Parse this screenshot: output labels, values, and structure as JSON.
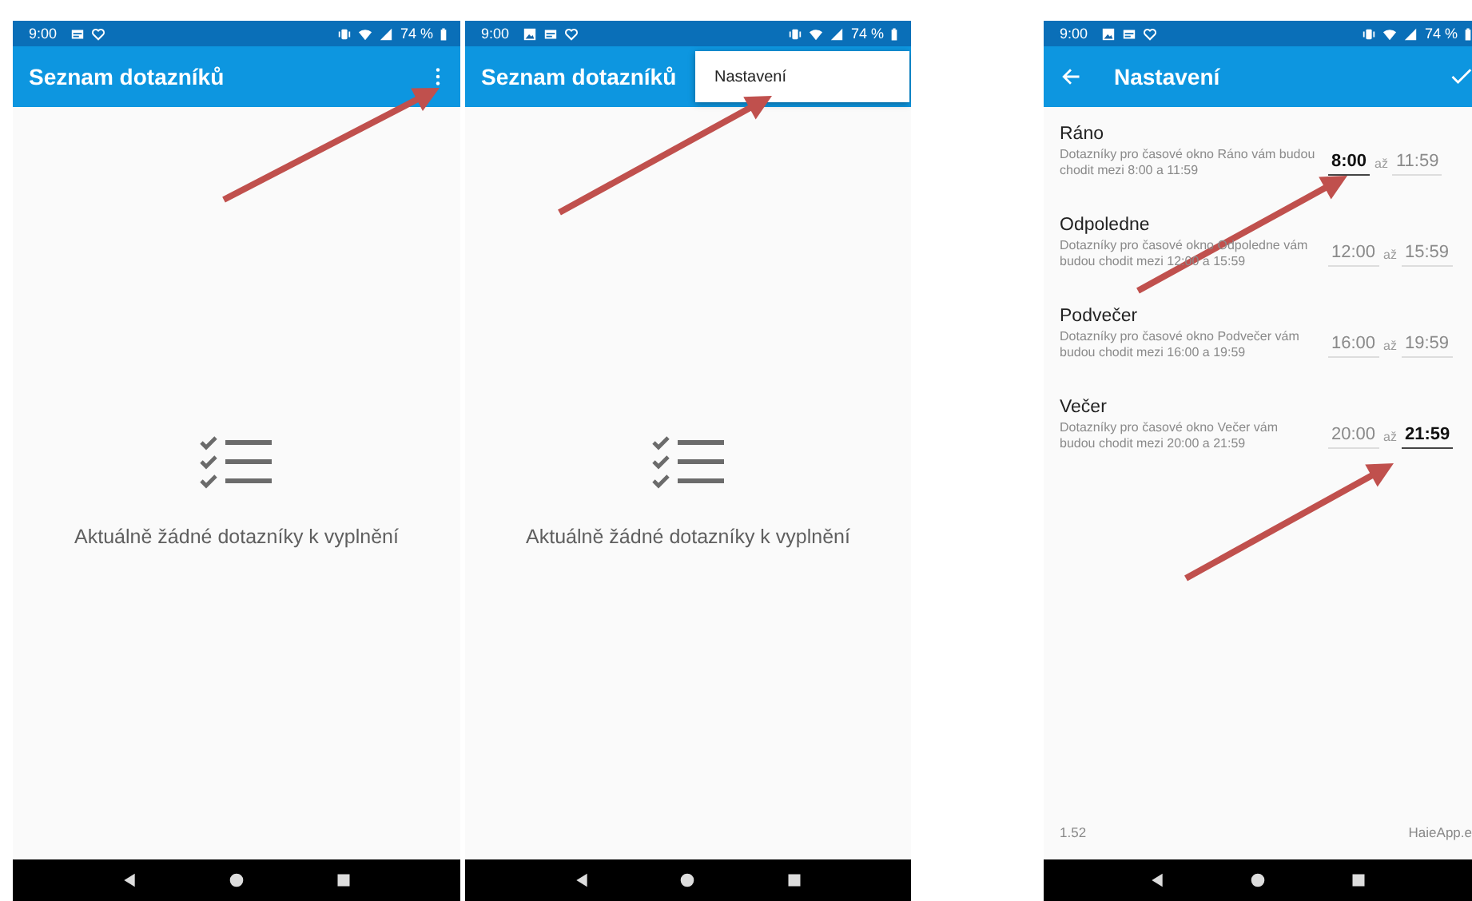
{
  "phones": [
    {
      "kind": "list",
      "status": {
        "time": "9:00",
        "notifications": [
          {
            "kind": "card"
          },
          {
            "kind": "heart"
          }
        ],
        "battery": "74 %"
      },
      "title": "Seznam dotazníků",
      "overflow_menu": true,
      "empty_message": "Aktuálně žádné dotazníky k vyplnění"
    },
    {
      "kind": "list",
      "status": {
        "time": "9:00",
        "notifications": [
          {
            "kind": "image"
          },
          {
            "kind": "card"
          },
          {
            "kind": "heart"
          }
        ],
        "battery": "74 %"
      },
      "title": "Seznam dotazníků",
      "menu": {
        "items": [
          "Nastavení"
        ]
      },
      "empty_message": "Aktuálně žádné dotazníky k vyplnění"
    },
    {
      "kind": "settings",
      "status": {
        "time": "9:00",
        "notifications": [
          {
            "kind": "image"
          },
          {
            "kind": "card"
          },
          {
            "kind": "heart"
          }
        ],
        "battery": "74 %"
      },
      "title": "Nastavení",
      "back": true,
      "confirm": true,
      "windows": [
        {
          "name": "Ráno",
          "description": "Dotazníky pro časové okno Ráno vám budou chodit mezi 8:00 a 11:59",
          "from": {
            "value": "8:00",
            "focused": true
          },
          "separator": "až",
          "to": {
            "value": "11:59",
            "focused": false
          }
        },
        {
          "name": "Odpoledne",
          "description": "Dotazníky pro časové okno Odpoledne vám budou chodit mezi 12:00 a 15:59",
          "from": {
            "value": "12:00",
            "focused": false
          },
          "separator": "až",
          "to": {
            "value": "15:59",
            "focused": false
          }
        },
        {
          "name": "Podvečer",
          "description": "Dotazníky pro časové okno Podvečer vám budou chodit mezi 16:00 a 19:59",
          "from": {
            "value": "16:00",
            "focused": false
          },
          "separator": "až",
          "to": {
            "value": "19:59",
            "focused": false
          }
        },
        {
          "name": "Večer",
          "description": "Dotazníky pro časové okno Večer vám budou chodit mezi 20:00 a 21:59",
          "from": {
            "value": "20:00",
            "focused": false
          },
          "separator": "až",
          "to": {
            "value": "21:59",
            "focused": true
          }
        }
      ],
      "footer": {
        "version": "1.52",
        "site": "HaieApp.e"
      }
    }
  ]
}
